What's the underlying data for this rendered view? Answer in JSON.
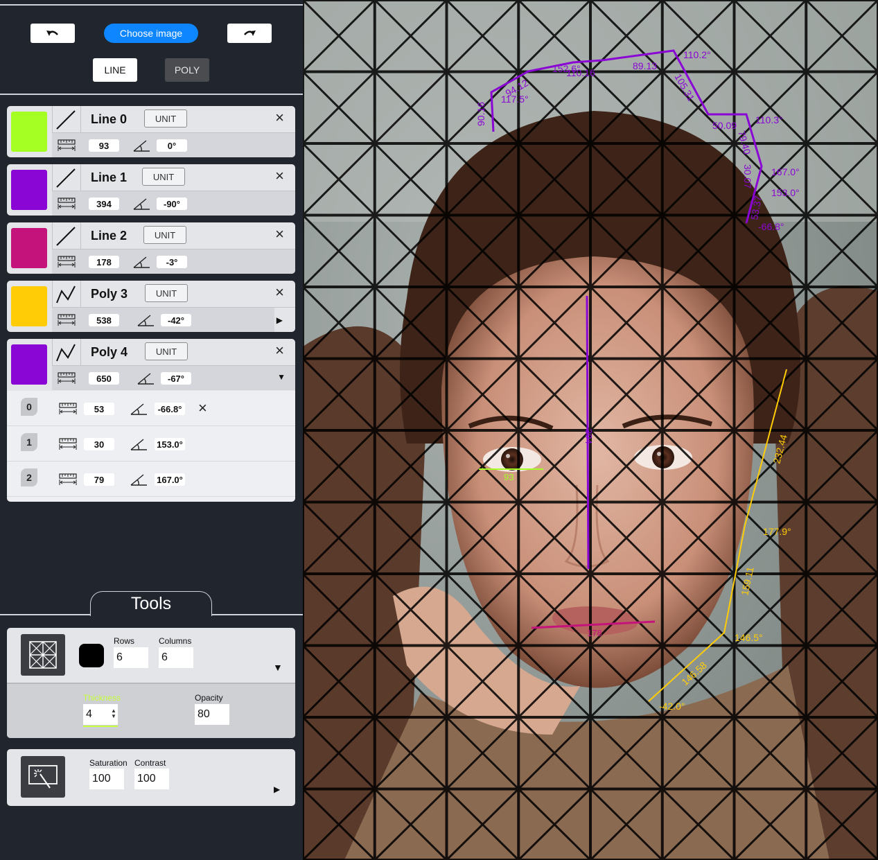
{
  "toolbar": {
    "choose_label": "Choose image",
    "line_label": "LINE",
    "poly_label": "POLY"
  },
  "lines": [
    {
      "name": "Line 0",
      "unit": "UNIT",
      "color": "#a6ff23",
      "type": "line",
      "length": "93",
      "angle": "0°"
    },
    {
      "name": "Line 1",
      "unit": "UNIT",
      "color": "#8a06d4",
      "type": "line",
      "length": "394",
      "angle": "-90°"
    },
    {
      "name": "Line 2",
      "unit": "UNIT",
      "color": "#c4147c",
      "type": "line",
      "length": "178",
      "angle": "-3°"
    },
    {
      "name": "Poly 3",
      "unit": "UNIT",
      "color": "#ffcc06",
      "type": "poly",
      "length": "538",
      "angle": "-42°"
    },
    {
      "name": "Poly 4",
      "unit": "UNIT",
      "color": "#8a06d4",
      "type": "poly",
      "length": "650",
      "angle": "-67°"
    }
  ],
  "segments": [
    {
      "index": "0",
      "length": "53",
      "angle": "-66.8°"
    },
    {
      "index": "1",
      "length": "30",
      "angle": "153.0°"
    },
    {
      "index": "2",
      "length": "79",
      "angle": "167.0°"
    }
  ],
  "tools": {
    "tab_label": "Tools",
    "grid": {
      "rows_label": "Rows",
      "rows_value": "6",
      "columns_label": "Columns",
      "columns_value": "6",
      "thickness_label": "Thickness",
      "thickness_value": "4",
      "opacity_label": "Opacity",
      "opacity_value": "80",
      "grid_color": "#000000"
    },
    "filter": {
      "saturation_label": "Saturation",
      "saturation_value": "100",
      "contrast_label": "Contrast",
      "contrast_value": "100"
    }
  },
  "annotations": {
    "line0_length": "93",
    "line1_length": "394",
    "line2_length": "178",
    "poly3": [
      "232.44",
      "177.9°",
      "159.11",
      "146.5°",
      "146.58",
      "-42.0°"
    ],
    "poly4": [
      "110.2°",
      "105.31",
      "110.3°",
      "50.09",
      "79.40",
      "167.0°",
      "30.07",
      "153.0°",
      "53.37",
      "-66.8°",
      "152.6°",
      "110.16",
      "89.13",
      "94.12",
      "117.5°",
      "90.16"
    ]
  }
}
